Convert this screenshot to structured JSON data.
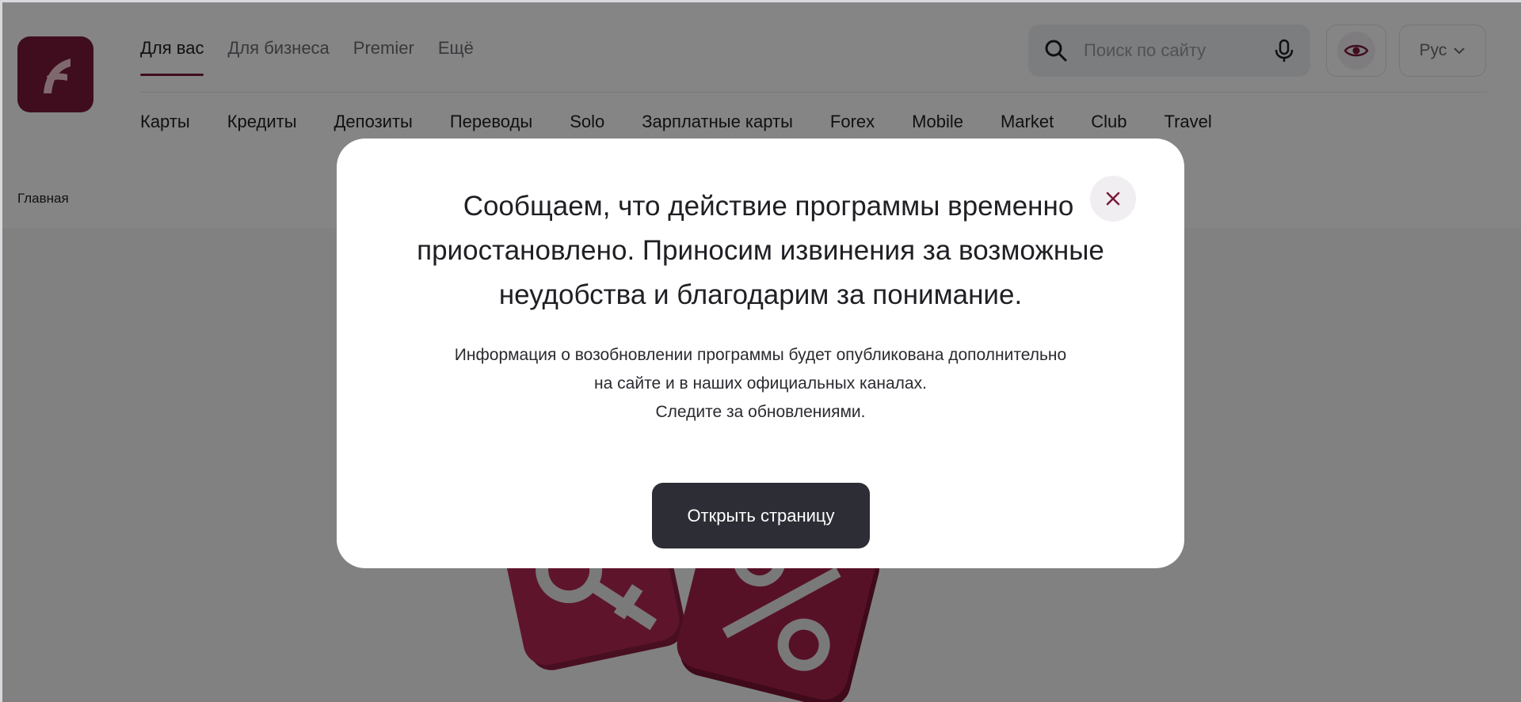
{
  "header": {
    "segments": [
      {
        "label": "Для вас",
        "active": true
      },
      {
        "label": "Для бизнеса",
        "active": false
      },
      {
        "label": "Premier",
        "active": false
      },
      {
        "label": "Ещё",
        "active": false
      }
    ],
    "search": {
      "placeholder": "Поиск по сайту",
      "value": ""
    },
    "language": "Рус",
    "products": [
      "Карты",
      "Кредиты",
      "Депозиты",
      "Переводы",
      "Solo",
      "Зарплатные карты",
      "Forex",
      "Mobile",
      "Market",
      "Club",
      "Travel"
    ],
    "breadcrumb": "Главная"
  },
  "modal": {
    "title_lines": [
      "Сообщаем, что действие программы временно",
      "приостановлено. Приносим извинения за возможные",
      "неудобства и благодарим за понимание."
    ],
    "body_lines": [
      "Информация о возобновлении программы будет опубликована дополнительно",
      "на сайте и в наших официальных каналах.",
      "Следите за обновлениями."
    ],
    "button_label": "Открыть страницу"
  },
  "colors": {
    "brand": "#7a1a3a",
    "button_dark": "#2d2e35",
    "overlay": "rgba(0,0,0,0.48)"
  },
  "icons": [
    "logo-icon",
    "search-icon",
    "microphone-icon",
    "eye-icon",
    "chevron-down-icon",
    "close-icon"
  ]
}
